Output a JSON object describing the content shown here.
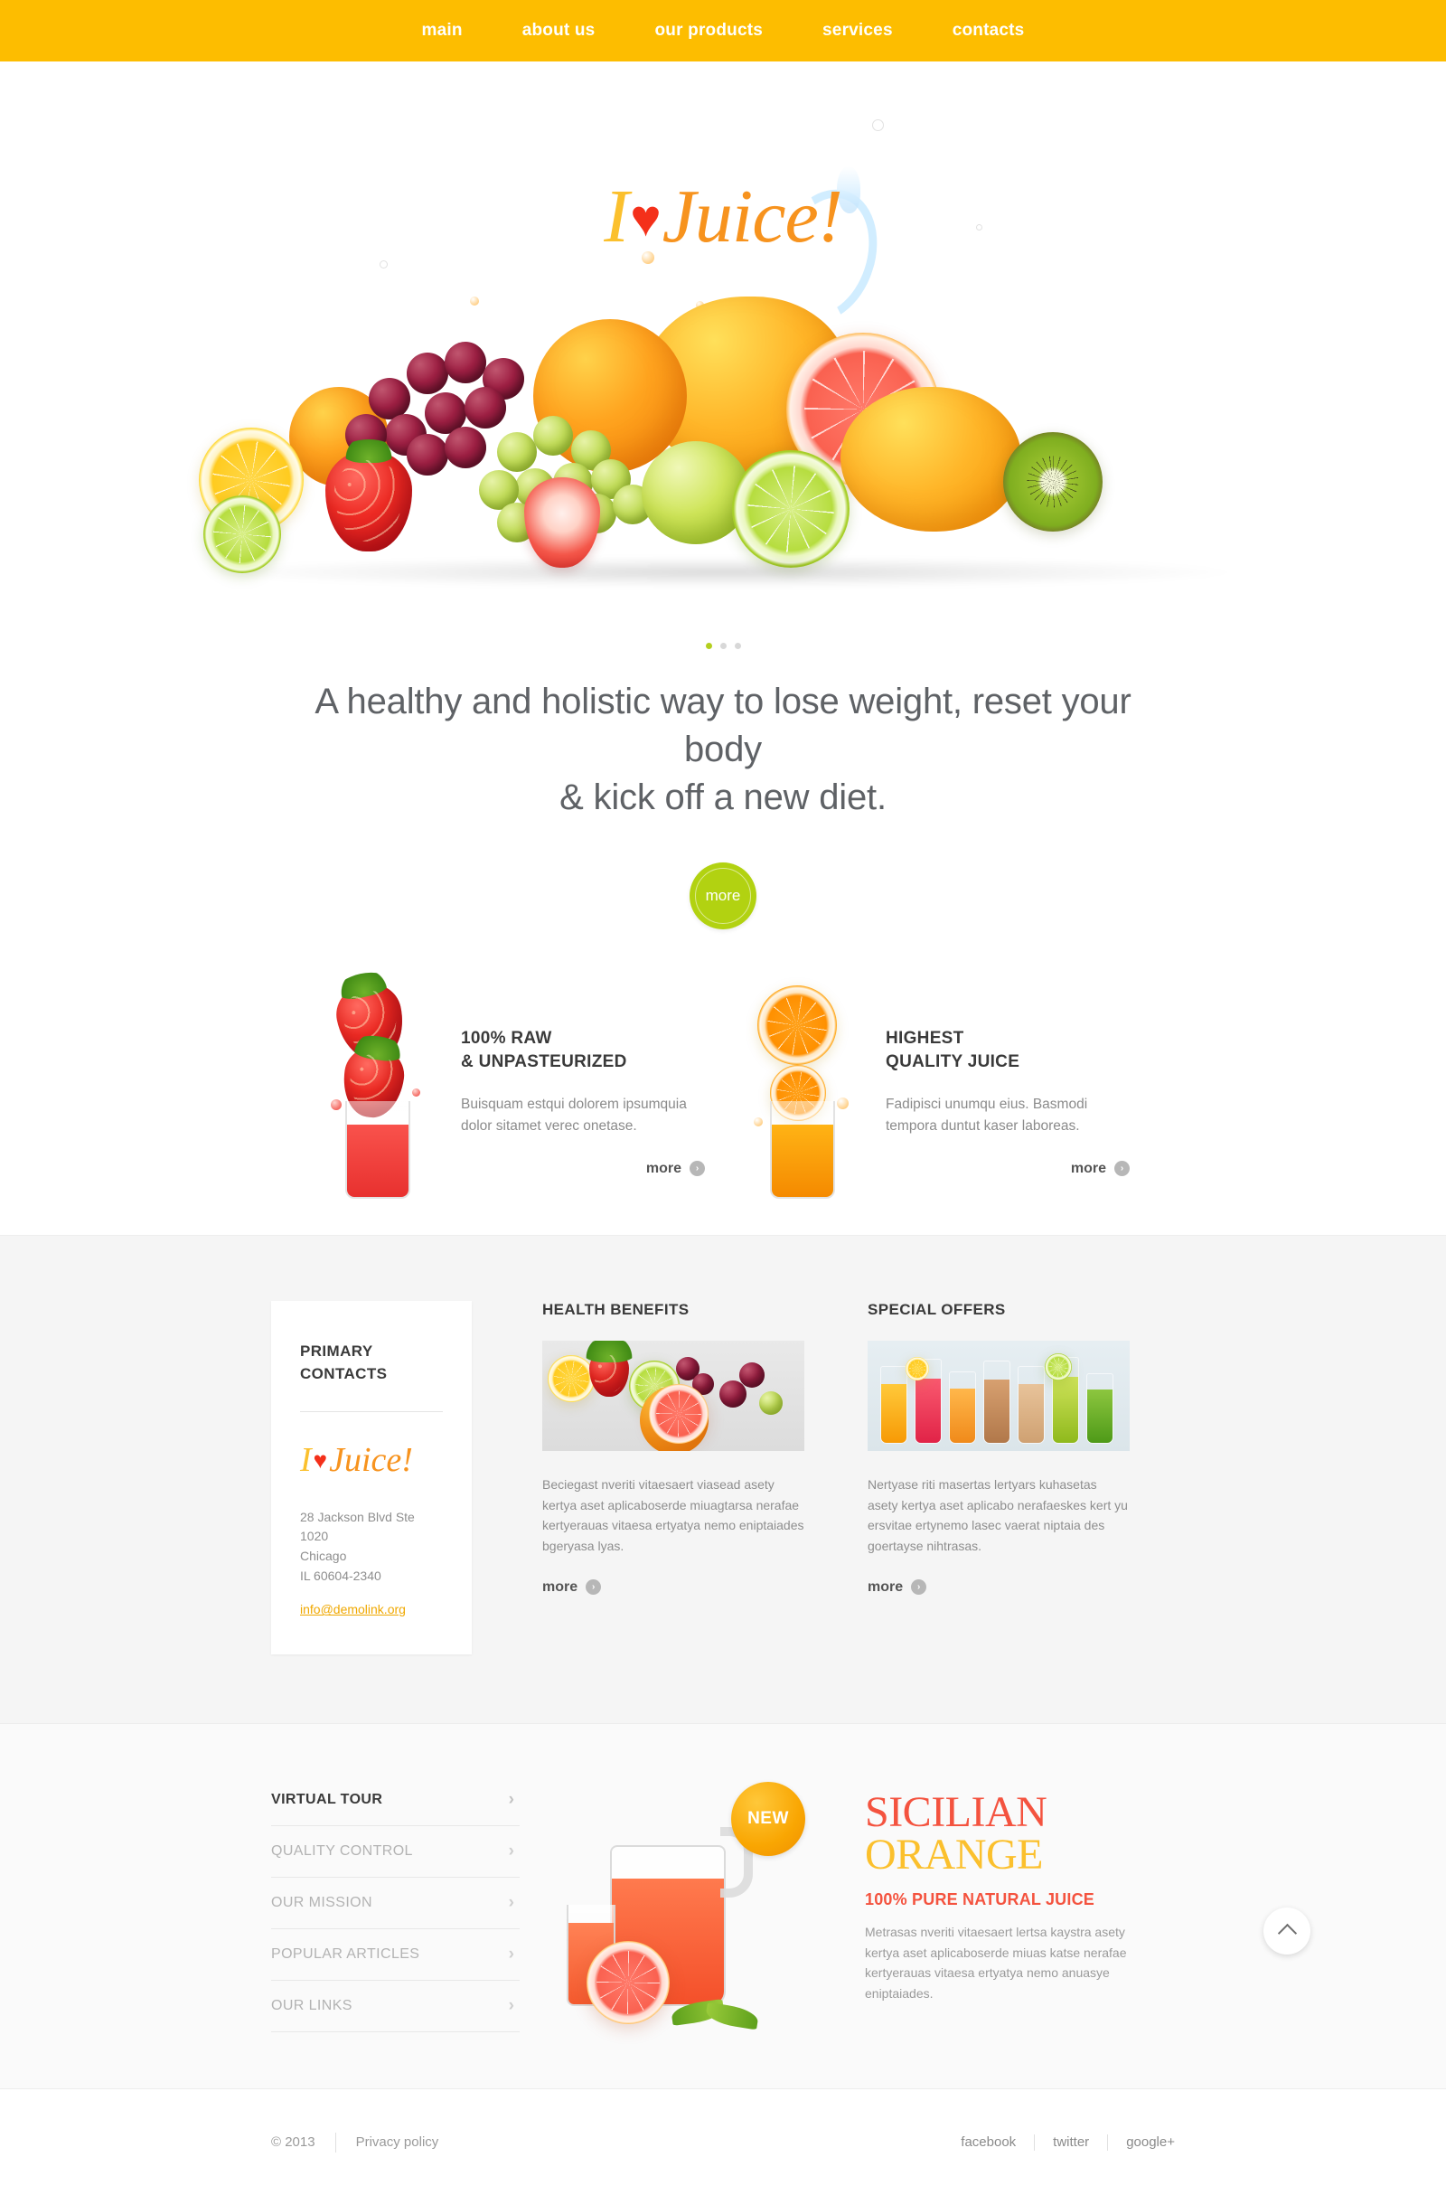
{
  "nav": {
    "items": [
      {
        "label": "main"
      },
      {
        "label": "about us"
      },
      {
        "label": "our products"
      },
      {
        "label": "services"
      },
      {
        "label": "contacts"
      }
    ]
  },
  "logo": {
    "i": "I",
    "heart": "♥",
    "word": "Juice!"
  },
  "hero": {
    "dots": [
      "active",
      "",
      ""
    ]
  },
  "tagline": {
    "line1": "A healthy and holistic way to lose weight, reset your body",
    "line2": "& kick off a new diet.",
    "more_label": "more"
  },
  "features": [
    {
      "title_line1": "100% RAW",
      "title_line2": "& UNPASTEURIZED",
      "text": "Buisquam estqui dolorem ipsumquia dolor sitamet verec onetase.",
      "more_label": "more",
      "arrow": "›"
    },
    {
      "title_line1": "HIGHEST",
      "title_line2": "QUALITY JUICE",
      "text": "Fadipisci unumqu eius. Basmodi tempora duntut kaser laboreas.",
      "more_label": "more",
      "arrow": "›"
    }
  ],
  "contacts": {
    "title_line1": "PRIMARY",
    "title_line2": "CONTACTS",
    "address_line1": "28 Jackson Blvd Ste 1020",
    "address_line2": "Chicago",
    "address_line3": "IL 60604-2340",
    "email": "info@demolink.org"
  },
  "columns": [
    {
      "title": "HEALTH BENEFITS",
      "text": "Beciegast nveriti vitaesaert viasead asety kertya aset aplicaboserde miuagtarsa nerafae kertyerauas vitaesa ertyatya nemo eniptaiades bgeryasa lyas.",
      "more_label": "more",
      "arrow": "›"
    },
    {
      "title": "SPECIAL OFFERS",
      "text": "Nertyase riti masertas lertyars kuhasetas asety kertya aset aplicabo nerafaeskes kert yu ersvitae ertynemo lasec vaerat niptaia des goertayse nihtrasas.",
      "more_label": "more",
      "arrow": "›"
    }
  ],
  "sidelist": {
    "items": [
      {
        "label": "VIRTUAL TOUR",
        "active": true
      },
      {
        "label": "QUALITY CONTROL",
        "active": false
      },
      {
        "label": "OUR MISSION",
        "active": false
      },
      {
        "label": "POPULAR ARTICLES",
        "active": false
      },
      {
        "label": "OUR LINKS",
        "active": false
      }
    ],
    "chevron": "›"
  },
  "promo": {
    "badge": "NEW",
    "headline_line1": "SICILIAN",
    "headline_line2": "ORANGE",
    "subtitle": "100% PURE NATURAL JUICE",
    "text": "Metrasas nveriti vitaesaert lertsa kaystra asety kertya aset aplicaboserde miuas katse nerafae kertyerauas vitaesa ertyatya nemo anuasye eniptaiades."
  },
  "footer": {
    "copyright": "© 2013",
    "privacy": "Privacy policy",
    "social": [
      "facebook",
      "twitter",
      "google+"
    ]
  },
  "colors": {
    "nav_yellow": "#FDBD00",
    "accent_green": "#b2d211",
    "orange": "#F7931E",
    "red": "#F4301A",
    "promo_red": "#f4533f",
    "promo_yellow": "#fbc02d"
  }
}
